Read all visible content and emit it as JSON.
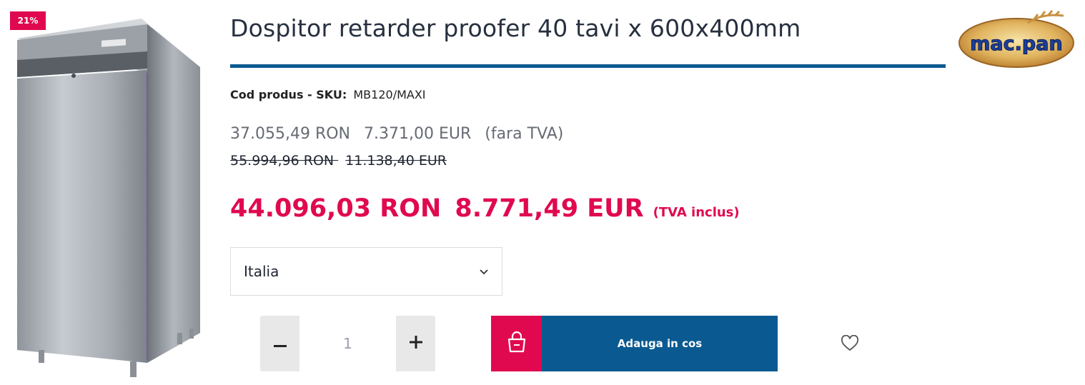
{
  "product": {
    "title": "Dospitor retarder proofer 40 tavi x 600x400mm",
    "discount_badge": "21%",
    "image_icon": "stainless-steel-cabinet-image",
    "sku_label": "Cod produs - SKU:",
    "sku_value": "MB120/MAXI"
  },
  "brand": {
    "logo_text": "mac.pan",
    "logo_icon": "wheat-logo-icon"
  },
  "prices": {
    "net_ron": "37.055,49 RON",
    "net_eur": "7.371,00 EUR",
    "net_note": "(fara TVA)",
    "old_ron": "55.994,96 RON",
    "old_eur": "11.138,40 EUR",
    "gross_ron": "44.096,03 RON",
    "gross_eur": "8.771,49 EUR",
    "gross_note": "(TVA inclus)"
  },
  "origin_select": {
    "selected": "Italia",
    "icon": "chevron-down-icon"
  },
  "quantity": {
    "value": "1",
    "minus_icon": "minus-icon",
    "plus_icon": "plus-icon"
  },
  "cart": {
    "label": "Adauga in cos",
    "icon": "shopping-bag-icon"
  },
  "wishlist": {
    "icon": "heart-icon"
  },
  "colors": {
    "accent_red": "#e0094f",
    "primary_blue": "#0a5a91",
    "text_dark": "#27303f",
    "muted_gray": "#666b73"
  }
}
